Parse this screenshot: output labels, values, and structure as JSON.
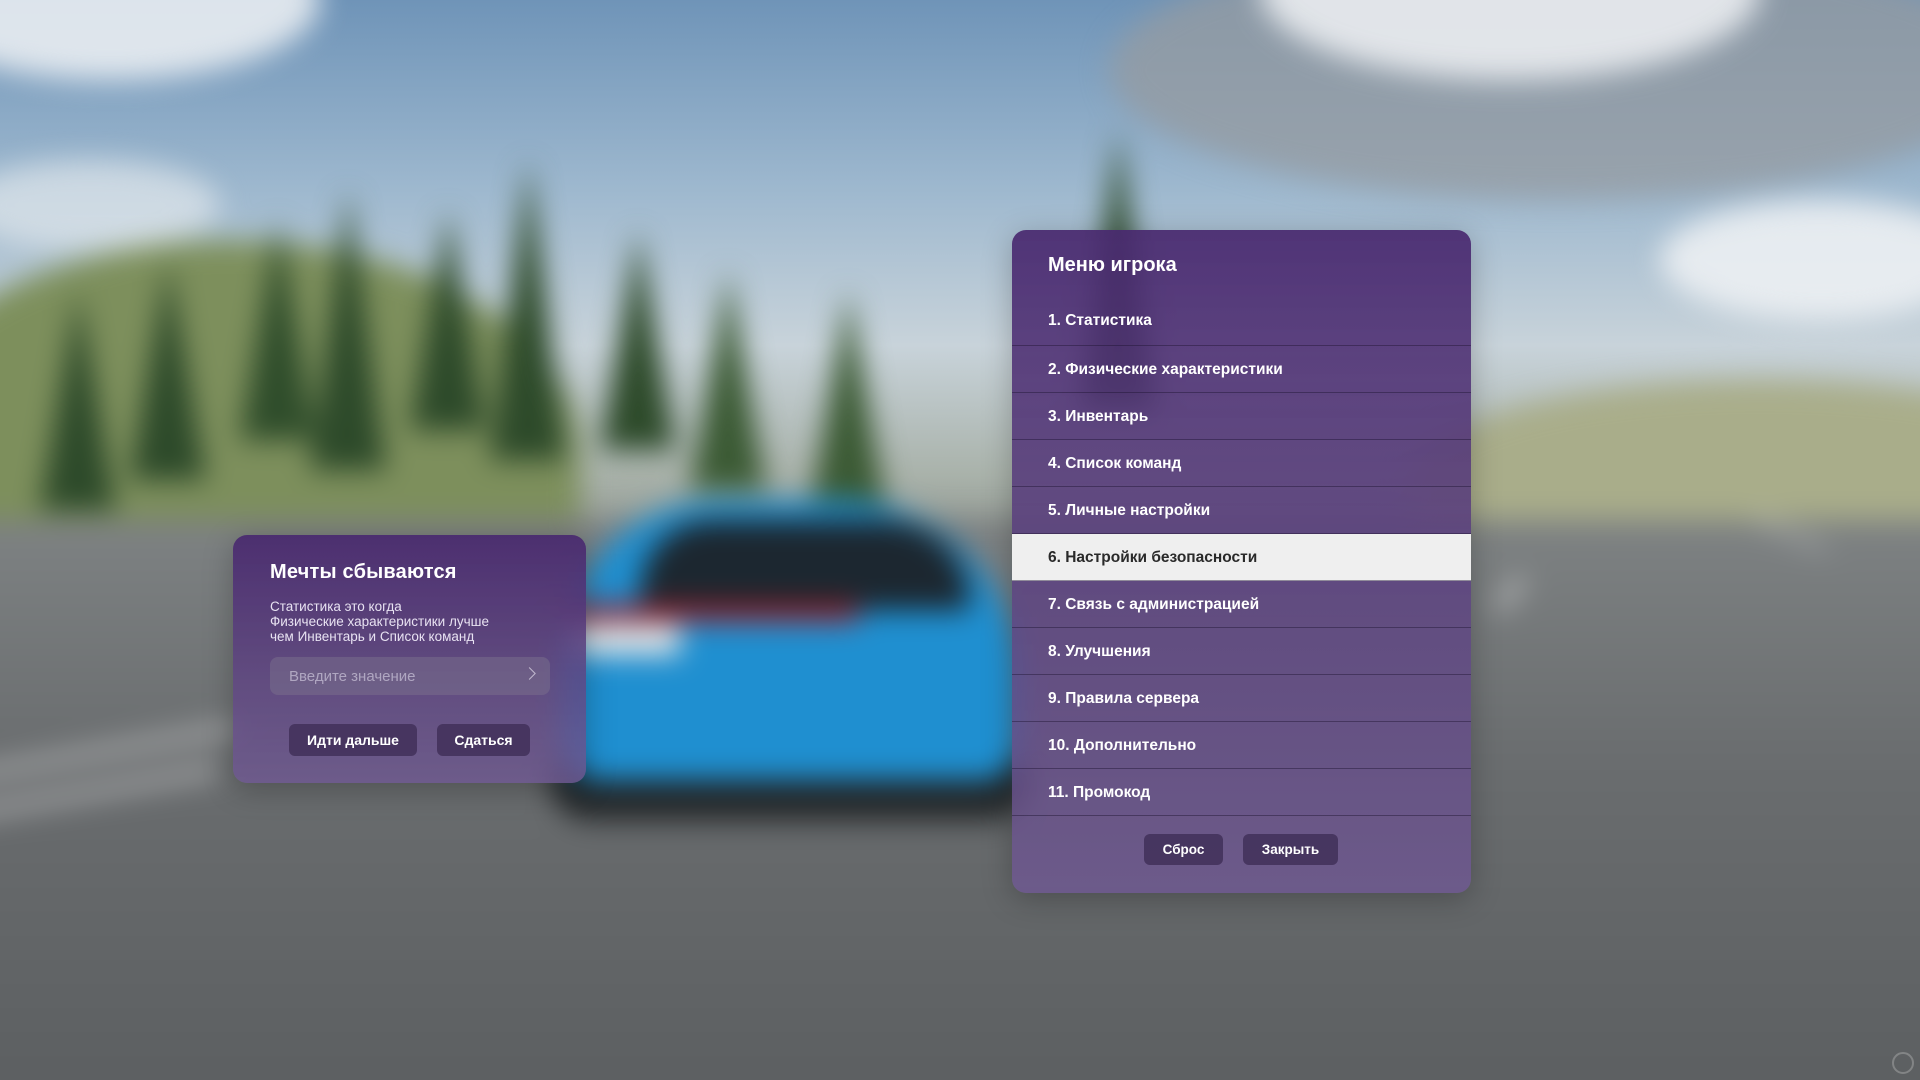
{
  "dream_panel": {
    "title": "Мечты сбываются",
    "text": "Статистика это когда\nФизические характеристики лучше\nчем Инвентарь и Список команд",
    "input_placeholder": "Введите значение",
    "input_value": "",
    "go_button": "Идти дальше",
    "giveup_button": "Сдаться"
  },
  "player_menu": {
    "title": "Меню игрока",
    "active_index": 5,
    "items": [
      {
        "label": "1. Статистика"
      },
      {
        "label": "2. Физические характеристики"
      },
      {
        "label": "3. Инвентарь"
      },
      {
        "label": "4. Список команд"
      },
      {
        "label": "5. Личные настройки"
      },
      {
        "label": "6. Настройки безопасности"
      },
      {
        "label": "7. Связь с администрацией"
      },
      {
        "label": "8. Улучшения"
      },
      {
        "label": "9. Правила сервера"
      },
      {
        "label": "10. Дополнительно"
      },
      {
        "label": "11. Промокод"
      }
    ],
    "reset_button": "Сброс",
    "close_button": "Закрыть"
  },
  "colors": {
    "panel_purple": "#48286e",
    "button_dark": "#44325c",
    "active_item_bg": "#efefef",
    "car_blue": "#1f8fd0"
  },
  "icons": [
    "chevron-right-icon",
    "corner-status-icon"
  ]
}
